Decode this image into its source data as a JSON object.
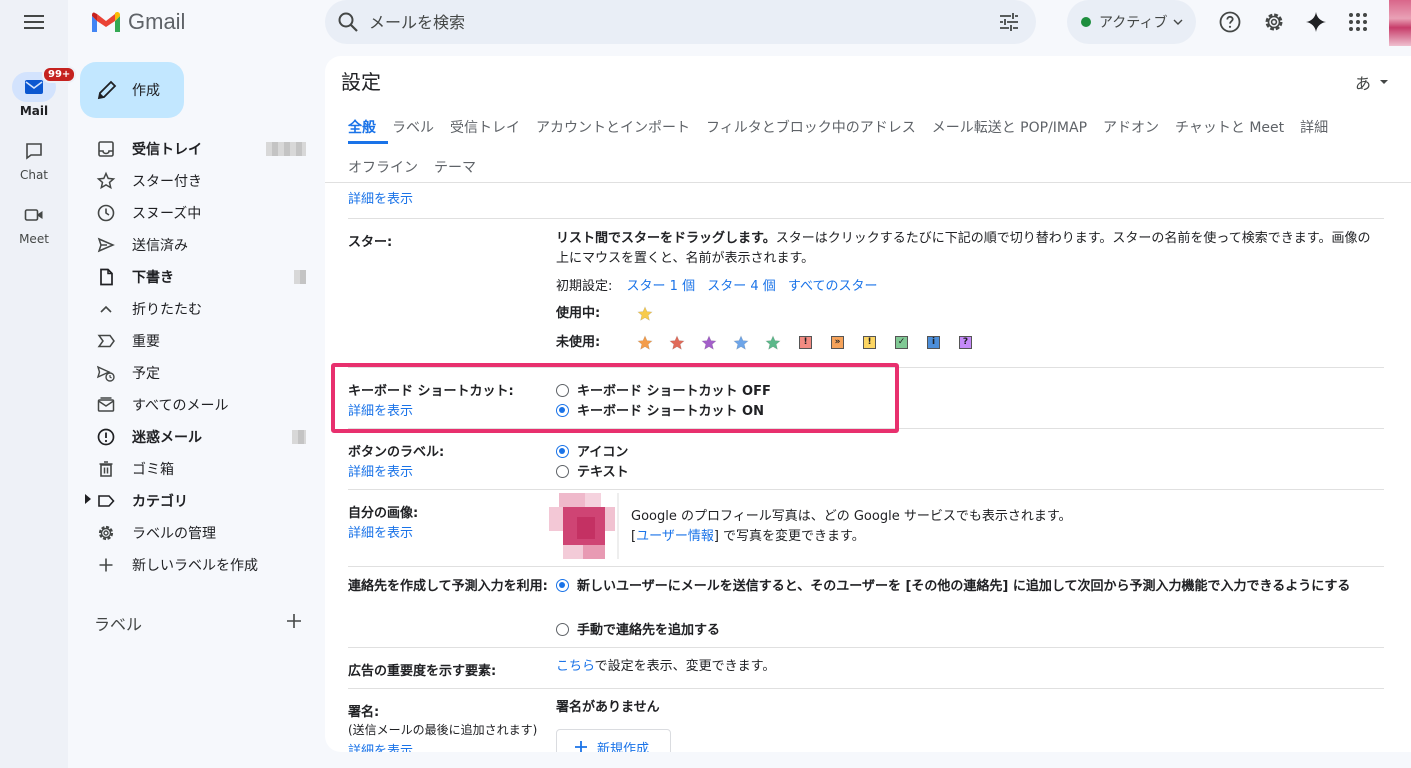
{
  "rail": {
    "items": [
      {
        "label": "Mail",
        "badge": "99+"
      },
      {
        "label": "Chat"
      },
      {
        "label": "Meet"
      }
    ]
  },
  "brand": {
    "name": "Gmail"
  },
  "search": {
    "placeholder": "メールを検索"
  },
  "status": {
    "label": "アクティブ"
  },
  "compose": {
    "label": "作成"
  },
  "nav": {
    "items": [
      {
        "label": "受信トレイ"
      },
      {
        "label": "スター付き"
      },
      {
        "label": "スヌーズ中"
      },
      {
        "label": "送信済み"
      },
      {
        "label": "下書き"
      },
      {
        "label": "折りたたむ"
      },
      {
        "label": "重要"
      },
      {
        "label": "予定"
      },
      {
        "label": "すべてのメール"
      },
      {
        "label": "迷惑メール"
      },
      {
        "label": "ゴミ箱"
      },
      {
        "label": "カテゴリ"
      },
      {
        "label": "ラベルの管理"
      },
      {
        "label": "新しいラベルを作成"
      }
    ],
    "labels_heading": "ラベル"
  },
  "settings": {
    "title": "設定",
    "lang": "あ",
    "tabs_row1": [
      "全般",
      "ラベル",
      "受信トレイ",
      "アカウントとインポート",
      "フィルタとブロック中のアドレス",
      "メール転送と POP/IMAP",
      "アドオン",
      "チャットと Meet",
      "詳細"
    ],
    "tabs_row2": [
      "オフライン",
      "テーマ"
    ],
    "show_details": "詳細を表示",
    "stars": {
      "label": "スター:",
      "desc_bold": "リスト間でスターをドラッグします。",
      "desc": "スターはクリックするたびに下記の順で切り替わります。スターの名前を使って検索できます。画像の上にマウスを置くと、名前が表示されます。",
      "presets_label": "初期設定:",
      "preset_1": "スター 1 個",
      "preset_4": "スター 4 個",
      "preset_all": "すべてのスター",
      "in_use": "使用中:",
      "not_in_use": "未使用:",
      "colors_in_use": [
        "#f7cb4d"
      ],
      "colors_unused": [
        "#f39c4a",
        "#e06b5a",
        "#a35fc9",
        "#6ea5e8",
        "#5cb88a"
      ],
      "markers_unused": [
        {
          "glyph": "!",
          "color": "#f28b82"
        },
        {
          "glyph": "»",
          "color": "#f6a35b"
        },
        {
          "glyph": "!",
          "color": "#fdd663"
        },
        {
          "glyph": "✓",
          "color": "#81c995"
        },
        {
          "glyph": "i",
          "color": "#4c8ed9"
        },
        {
          "glyph": "?",
          "color": "#c58af9"
        }
      ]
    },
    "shortcuts": {
      "label": "キーボード ショートカット:",
      "off": "キーボード ショートカット OFF",
      "on": "キーボード ショートカット ON",
      "selected": "on"
    },
    "button_labels": {
      "label": "ボタンのラベル:",
      "icons": "アイコン",
      "text": "テキスト",
      "selected": "icons"
    },
    "my_picture": {
      "label": "自分の画像:",
      "line1": "Google のプロフィール写真は、どの Google サービスでも表示されます。",
      "bracket_open": "[",
      "link": "ユーザー情報",
      "line2": "] で写真を変更できます。"
    },
    "autocomplete": {
      "label": "連絡先を作成して予測入力を利用:",
      "opt1": "新しいユーザーにメールを送信すると、そのユーザーを [その他の連絡先] に追加して次回から予測入力機能で入力できるようにする",
      "opt2": "手動で連絡先を追加する",
      "selected": "opt1"
    },
    "ads": {
      "label": "広告の重要度を示す要素:",
      "link": "こちら",
      "text": "で設定を表示、変更できます。"
    },
    "signature": {
      "label": "署名:",
      "sub": "(送信メールの最後に追加されます)",
      "none": "署名がありません",
      "new_button": "新規作成"
    }
  }
}
